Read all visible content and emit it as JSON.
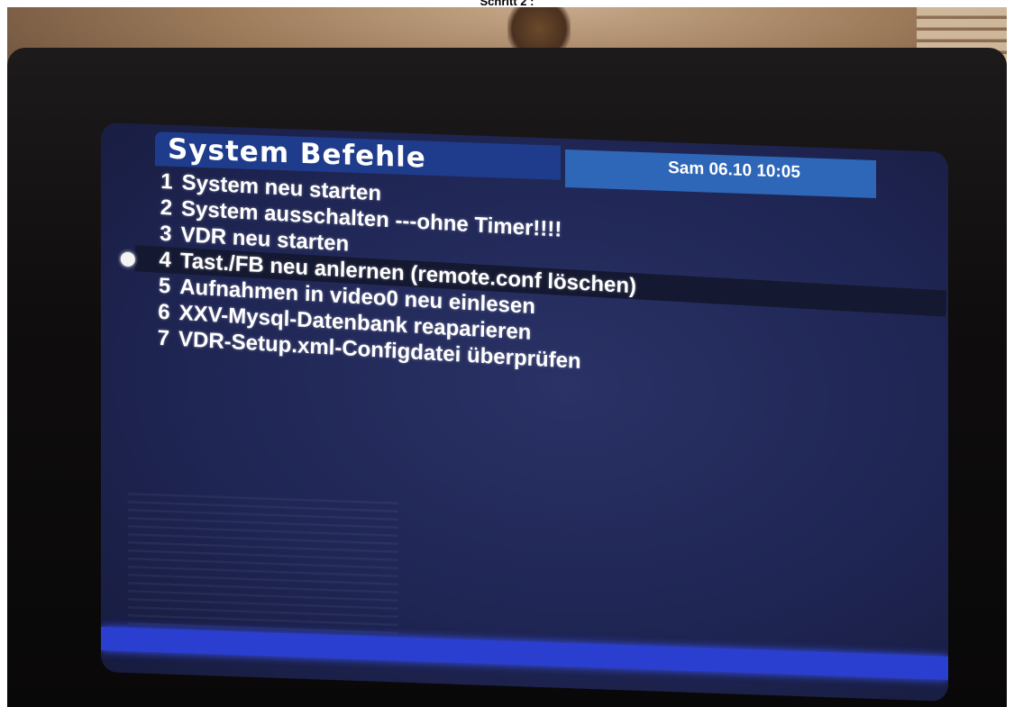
{
  "page_caption": "Schritt 2 :",
  "osd": {
    "title": "System Befehle",
    "datetime": "Sam 06.10 10:05",
    "selected_index": 3,
    "items": [
      {
        "number": "1",
        "label": "System neu starten"
      },
      {
        "number": "2",
        "label": "System ausschalten ---ohne Timer!!!!"
      },
      {
        "number": "3",
        "label": "VDR neu starten"
      },
      {
        "number": "4",
        "label": "Tast./FB neu anlernen (remote.conf löschen)"
      },
      {
        "number": "5",
        "label": "Aufnahmen in video0 neu einlesen"
      },
      {
        "number": "6",
        "label": "XXV-Mysql-Datenbank reaparieren"
      },
      {
        "number": "7",
        "label": "VDR-Setup.xml-Configdatei überprüfen"
      }
    ]
  },
  "colors": {
    "title_bar": "#1f3c8c",
    "date_bar": "#2e66b8",
    "screen_bg": "#1f2654",
    "status_bar": "#2a3fcf"
  }
}
